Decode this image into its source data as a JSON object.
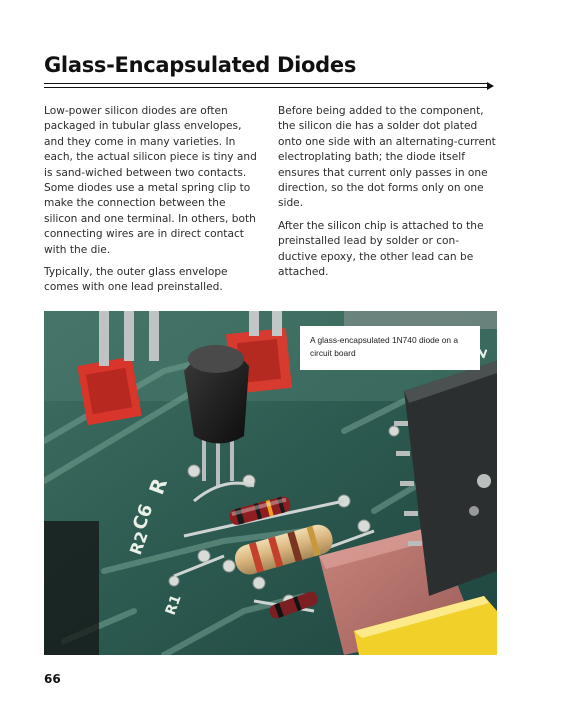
{
  "title": "Glass-Encapsulated Diodes",
  "left_column": [
    "Low-power silicon diodes are often packaged in tubular glass envelopes, and they come in many varieties. In each, the actual silicon piece is tiny and is sand-wiched between two contacts. Some diodes use a metal spring clip to make the connection between the silicon and one terminal. In others, both connecting wires are in direct contact with the die.",
    "Typically, the outer glass envelope comes with one lead preinstalled."
  ],
  "right_column": [
    "Before being added to the component, the silicon die has a solder dot plated onto one side with an alternating-current electroplating bath; the diode itself ensures that current only passes in one direction, so the dot forms only on one side.",
    "After the silicon chip is attached to the preinstalled lead by solder or con-ductive epoxy, the other lead can be attached."
  ],
  "photo": {
    "caption": "A glass-encapsulated 1N740 diode on a circuit board"
  },
  "page_number": "66"
}
